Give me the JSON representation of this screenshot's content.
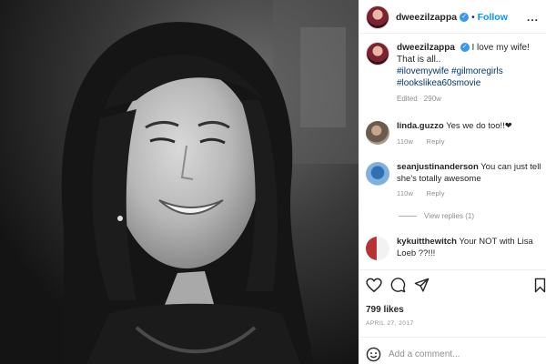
{
  "post": {
    "username": "dweezilzappa",
    "follow_label": "Follow",
    "separator": "•",
    "more_label": "..."
  },
  "caption": {
    "username": "dweezilzappa",
    "text": "I love my wife! That is all..",
    "hashtags": "#ilovemywife #gilmoregirls #lookslikea60smovie",
    "edited": "Edited · 290w"
  },
  "comments": [
    {
      "username": "linda.guzzo",
      "text": "Yes we do too!!❤",
      "time": "110w",
      "reply": "Reply"
    },
    {
      "username": "seanjustinanderson",
      "text": "You can just tell she's totally awesome",
      "time": "110w",
      "reply": "Reply"
    },
    {
      "username": "kykuitthewitch",
      "text": "Your NOT with Lisa Loeb ??!!!",
      "time": "",
      "reply": ""
    }
  ],
  "view_replies": "View replies (1)",
  "likes": "799 likes",
  "date": "APRIL 27, 2017",
  "add_comment_placeholder": "Add a comment...",
  "icons": [
    "heart-icon",
    "comment-icon",
    "share-icon",
    "bookmark-icon",
    "emoji-icon",
    "verified-icon"
  ],
  "colors": {
    "link": "#0095f6",
    "verified": "#3897f0",
    "muted": "#8e8e8e"
  }
}
